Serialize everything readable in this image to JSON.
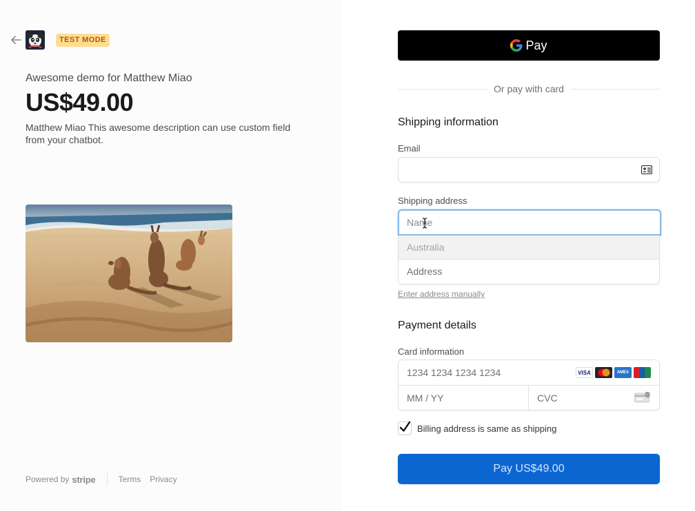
{
  "header": {
    "badge": "TEST MODE"
  },
  "product": {
    "name": "Awesome demo for Matthew Miao",
    "price": "US$49.00",
    "description": "Matthew Miao This awesome description can use custom field from your chatbot."
  },
  "footer": {
    "powered_by": "Powered by",
    "brand": "stripe",
    "terms": "Terms",
    "privacy": "Privacy"
  },
  "wallet": {
    "label": "Pay"
  },
  "divider_text": "Or pay with card",
  "shipping": {
    "title": "Shipping information",
    "email_label": "Email",
    "email_value": "",
    "address_label": "Shipping address",
    "name_placeholder": "Name",
    "country": "Australia",
    "address_placeholder": "Address",
    "manual_link": "Enter address manually"
  },
  "payment": {
    "title": "Payment details",
    "card_label": "Card information",
    "card_number_placeholder": "1234 1234 1234 1234",
    "expiry_placeholder": "MM / YY",
    "cvc_placeholder": "CVC",
    "brands": [
      "VISA",
      "mastercard",
      "AMEX",
      "UnionPay"
    ],
    "billing_same_label": "Billing address is same as shipping",
    "billing_same_checked": true
  },
  "pay_button": "Pay US$49.00",
  "colors": {
    "accent": "#0b66d1",
    "badge_bg": "#ffdd8f",
    "badge_text": "#b3590b"
  }
}
